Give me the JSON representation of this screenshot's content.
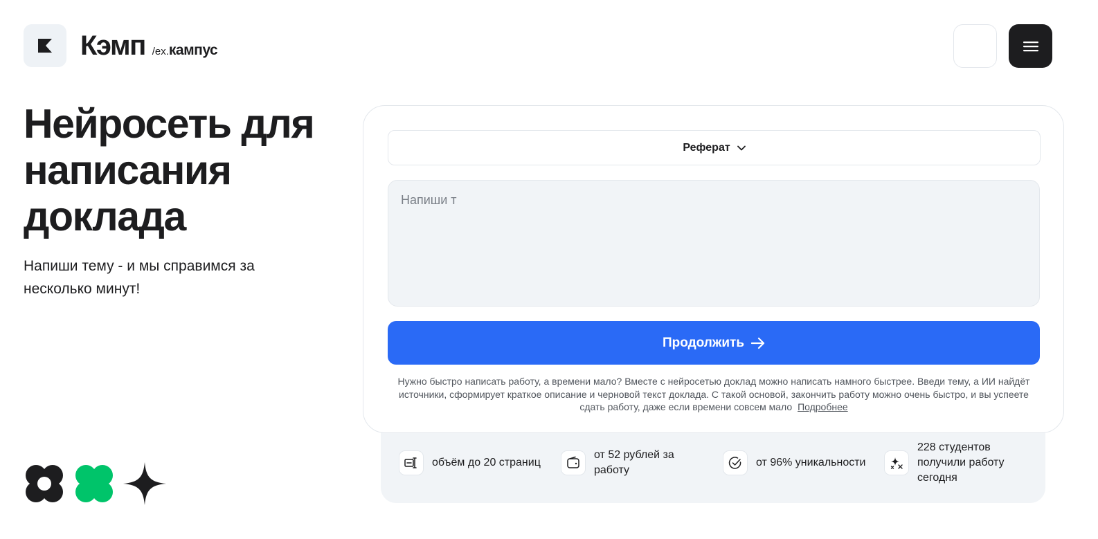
{
  "header": {
    "brand_name": "Кэмп",
    "brand_ex_prefix": "/ex.",
    "brand_ex_name": "кампус",
    "logo_icon": "k-logo-icon",
    "menu_icon": "hamburger-menu-icon"
  },
  "hero": {
    "title": "Нейросеть для написания доклада",
    "subtitle": "Напиши тему - и мы справимся за несколько минут!"
  },
  "form": {
    "type_selected": "Реферат",
    "topic_value": "",
    "topic_placeholder": "Напиши т",
    "continue_label": "Продолжить",
    "description": "Нужно быстро написать работу, а времени мало? Вместе с нейросетью доклад можно написать намного быстрее. Введи тему, а ИИ найдёт источники, сформирует краткое описание и черновой текст доклада. С такой основой, закончить работу можно очень быстро, и вы успеете сдать работу, даже если времени совсем мало",
    "more_link": "Подробнее"
  },
  "features": [
    {
      "icon": "text-cursor-icon",
      "text": "объём до 20 страниц"
    },
    {
      "icon": "wallet-icon",
      "text": "от 52 рублей за работу"
    },
    {
      "icon": "check-circle-icon",
      "text": "от 96% уникальности"
    },
    {
      "icon": "sparkles-icon",
      "text": "228 студентов получили работу сегодня"
    }
  ],
  "colors": {
    "accent": "#2a6af6",
    "dark": "#1d1d1f",
    "green": "#00c46a",
    "surface": "#f1f4f7"
  }
}
